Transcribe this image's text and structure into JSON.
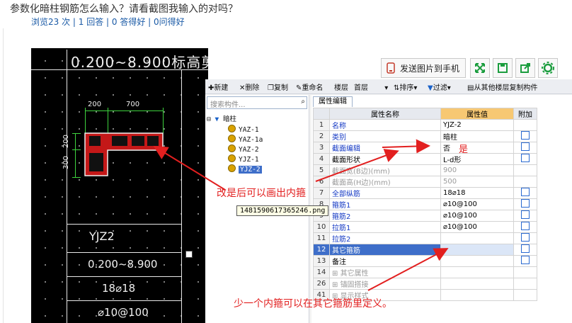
{
  "question": {
    "title": "参数化暗柱钢筋怎么输入？请看截图我输入的对吗？",
    "stats": "浏览23 次 | 1 回答 | 0 答得好 | 0问得好"
  },
  "cad": {
    "title": "0.200~8.900标高剪",
    "dim_200": "200",
    "dim_700": "700",
    "dim_v200": "200",
    "dim_v300": "300",
    "label": "YJZ2",
    "elev": "0.200~8.900",
    "rebar": "18⌀18",
    "stirrup": "⌀10@100"
  },
  "top_actions": {
    "send_phone": "发送图片到手机",
    "icons": [
      "expand-icon",
      "save-icon",
      "share-icon",
      "settings-icon"
    ]
  },
  "toolbar": {
    "new": "新建",
    "delete": "删除",
    "copy": "复制",
    "rename": "重命名",
    "floor": "楼层",
    "floor_value": "首层",
    "sort": "排序",
    "filter": "过滤",
    "copy_from": "从其他楼层复制构件"
  },
  "tree": {
    "search_placeholder": "搜索构件...",
    "root": "暗柱",
    "items": [
      "YAZ-1",
      "YAZ-1a",
      "YAZ-2",
      "YJZ-1",
      "YJZ-2"
    ]
  },
  "props": {
    "tab": "属性编辑",
    "headers": {
      "name": "属性名称",
      "value": "属性值",
      "add": "附加"
    },
    "rows": [
      {
        "num": "1",
        "name": "名称",
        "value": "YJZ-2"
      },
      {
        "num": "2",
        "name": "类别",
        "value": "暗柱"
      },
      {
        "num": "3",
        "name": "截面编辑",
        "value": "否"
      },
      {
        "num": "4",
        "name": "截面形状",
        "value": "L-d形"
      },
      {
        "num": "5",
        "name": "截面宽(B边)(mm)",
        "value": "900"
      },
      {
        "num": "6",
        "name": "截面高(H边)(mm)",
        "value": "500"
      },
      {
        "num": "7",
        "name": "全部纵筋",
        "value": "18⌀18"
      },
      {
        "num": "8",
        "name": "箍筋1",
        "value": "⌀10@100"
      },
      {
        "num": "9",
        "name": "箍筋2",
        "value": "⌀10@100"
      },
      {
        "num": "10",
        "name": "拉筋1",
        "value": "⌀10@100"
      },
      {
        "num": "11",
        "name": "拉筋2",
        "value": ""
      },
      {
        "num": "12",
        "name": "其它箍筋",
        "value": ""
      },
      {
        "num": "13",
        "name": "备注",
        "value": ""
      },
      {
        "num": "14",
        "name": "其它属性",
        "value": ""
      },
      {
        "num": "26",
        "name": "锚固搭接",
        "value": ""
      },
      {
        "num": "41",
        "name": "显示样式",
        "value": ""
      }
    ]
  },
  "annotations": {
    "shi": "是",
    "note1": "改是后可以画出内箍",
    "note2": "少一个内箍可以在其它箍筋里定义。",
    "tooltip": "1481590617365246.png"
  },
  "colors": {
    "annotation_red": "#e21f1f",
    "selected_row": "#3e6ec9",
    "value_header": "#f7c873"
  }
}
